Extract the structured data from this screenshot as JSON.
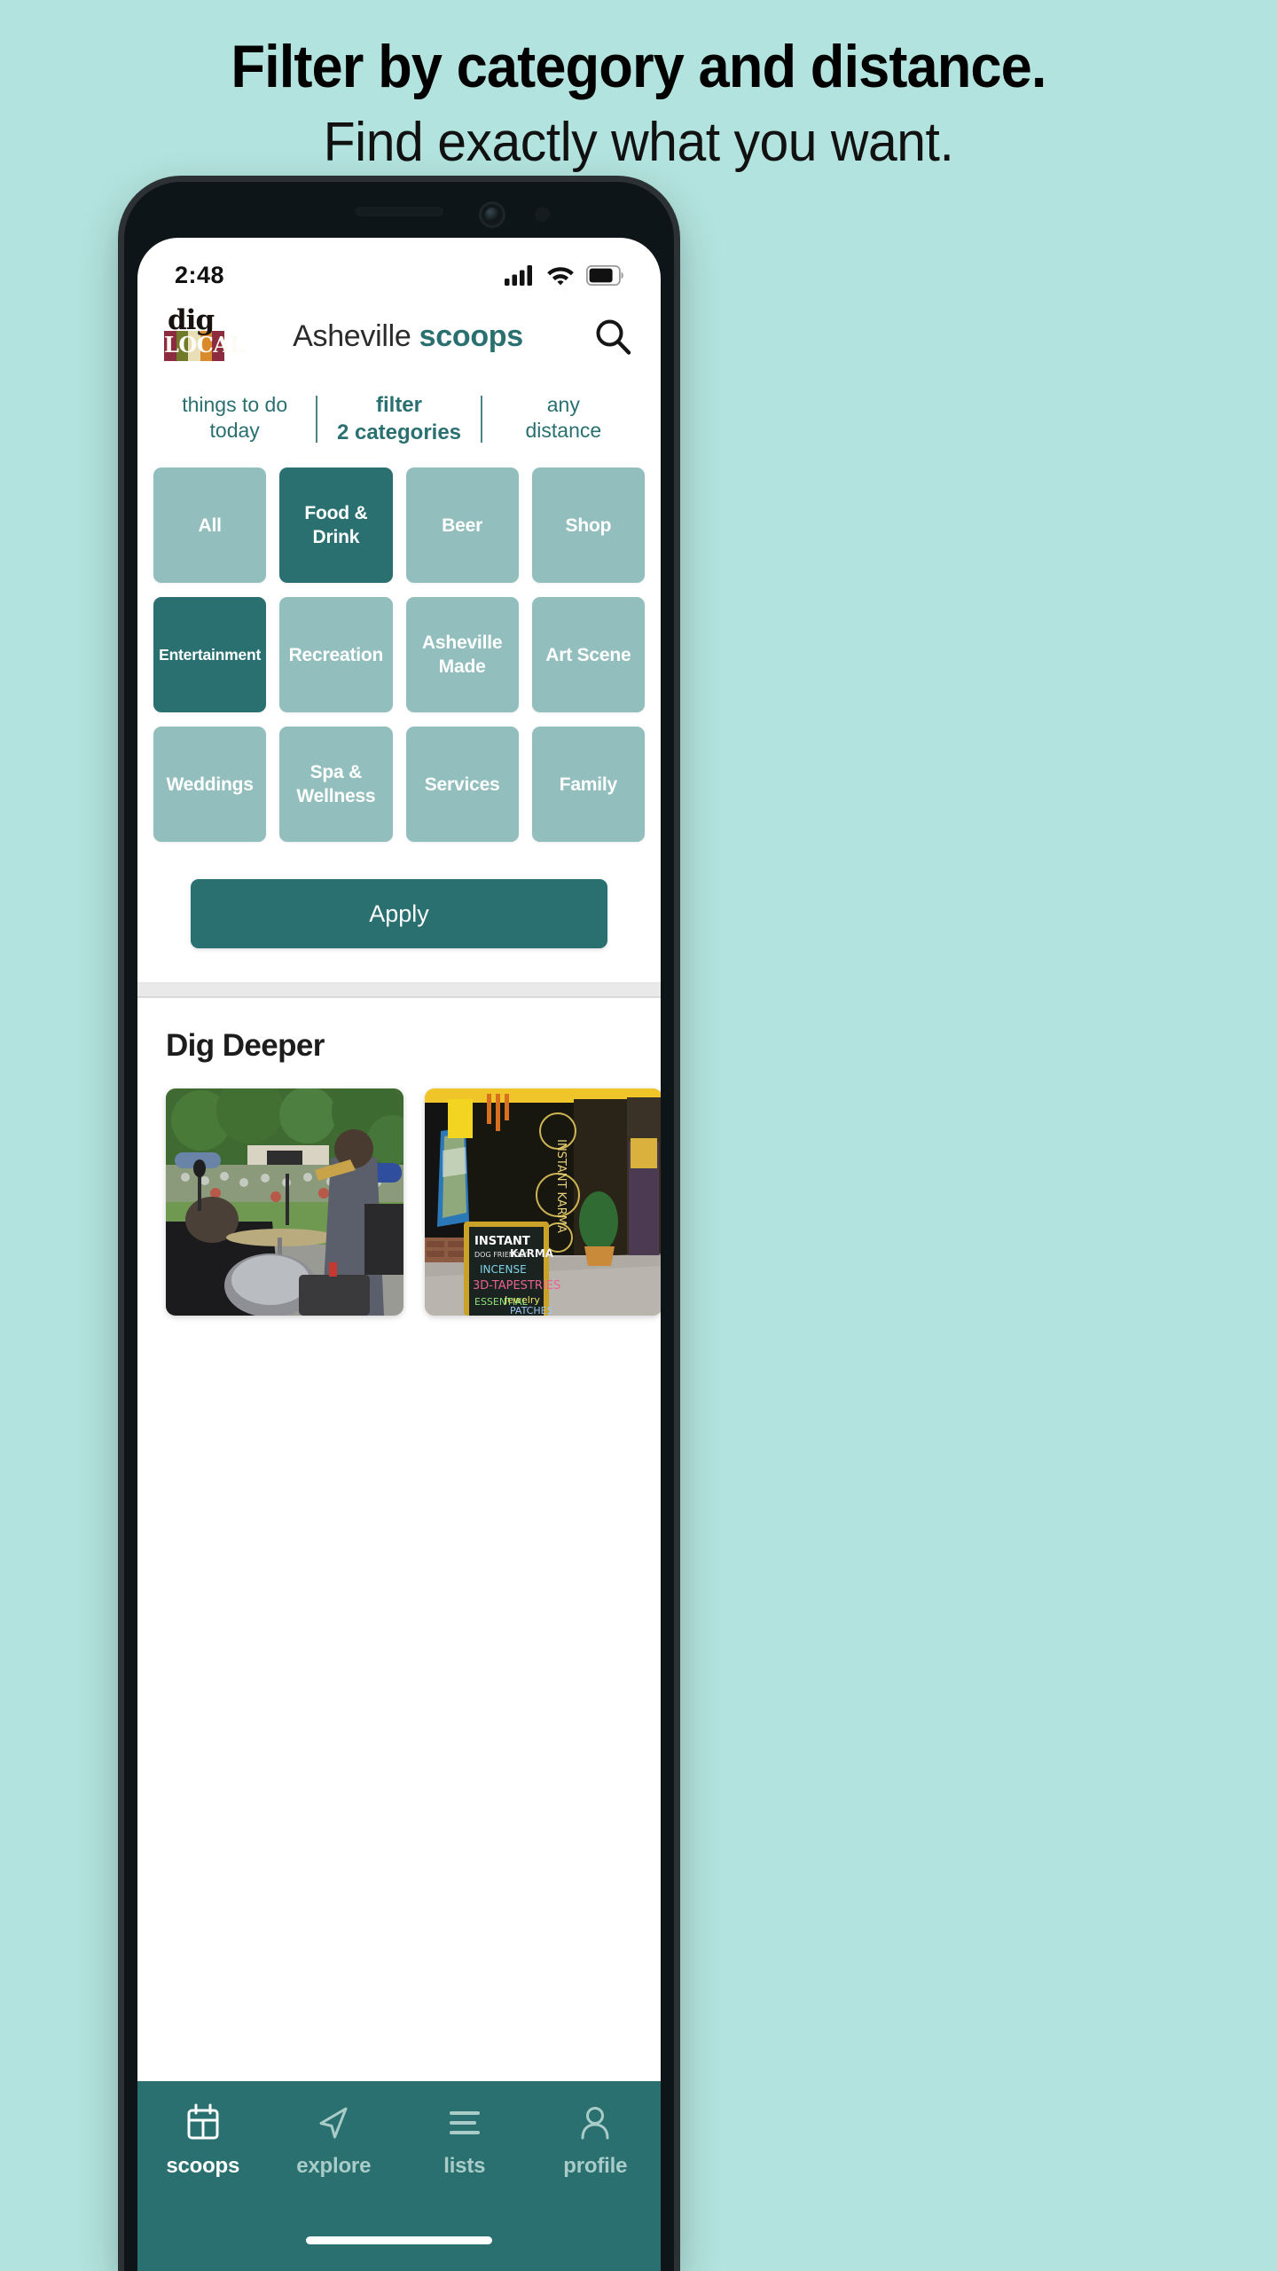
{
  "promo": {
    "line1": "Filter by category and distance.",
    "line2": "Find exactly what you want."
  },
  "phone": {
    "status": {
      "time": "2:48",
      "signal_icon": "cellular-signal-icon",
      "wifi_icon": "wifi-icon",
      "battery_icon": "battery-icon"
    }
  },
  "header": {
    "logo_top": "dig",
    "logo_bottom": "LOCAL",
    "title_prefix": "Asheville ",
    "title_bold": "scoops",
    "search_icon": "search-icon"
  },
  "tabs": [
    {
      "line1": "things to do",
      "line2": "today",
      "active": false
    },
    {
      "line1": "filter",
      "line2": "2 categories",
      "active": true
    },
    {
      "line1": "any",
      "line2": "distance",
      "active": false
    }
  ],
  "categories": [
    {
      "label": "All",
      "selected": false
    },
    {
      "label": "Food & Drink",
      "selected": true
    },
    {
      "label": "Beer",
      "selected": false
    },
    {
      "label": "Shop",
      "selected": false
    },
    {
      "label": "Entertainment",
      "selected": true
    },
    {
      "label": "Recreation",
      "selected": false
    },
    {
      "label": "Asheville Made",
      "selected": false
    },
    {
      "label": "Art Scene",
      "selected": false
    },
    {
      "label": "Weddings",
      "selected": false
    },
    {
      "label": "Spa & Wellness",
      "selected": false
    },
    {
      "label": "Services",
      "selected": false
    },
    {
      "label": "Family",
      "selected": false
    }
  ],
  "apply_label": "Apply",
  "dig_deeper": {
    "title": "Dig Deeper",
    "cards": [
      {
        "name": "outdoor-concert-photo"
      },
      {
        "name": "instant-karma-storefront-photo"
      }
    ]
  },
  "bottom_nav": [
    {
      "label": "scoops",
      "icon": "calendar-icon",
      "active": true
    },
    {
      "label": "explore",
      "icon": "navigation-arrow-icon",
      "active": false
    },
    {
      "label": "lists",
      "icon": "list-lines-icon",
      "active": false
    },
    {
      "label": "profile",
      "icon": "person-icon",
      "active": false
    }
  ],
  "colors": {
    "background": "#b3e3de",
    "accent_dark": "#2a7070",
    "accent_light": "#92bfbd"
  }
}
